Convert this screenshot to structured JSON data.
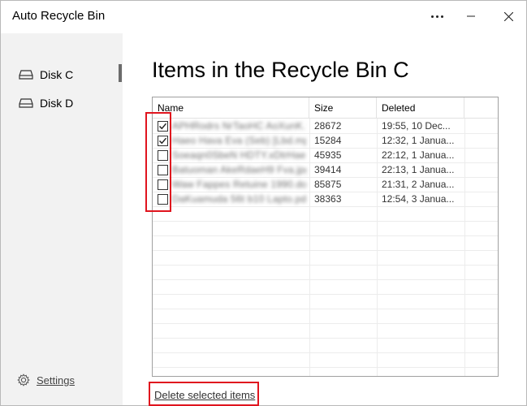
{
  "window": {
    "title": "Auto Recycle Bin"
  },
  "sidebar": {
    "items": [
      {
        "label": "Disk C",
        "icon": "drive-icon",
        "selected": true
      },
      {
        "label": "Disk D",
        "icon": "drive-icon",
        "selected": false
      }
    ],
    "settings_label": "Settings",
    "settings_icon": "gear-icon"
  },
  "main": {
    "title": "Items in the Recycle Bin C",
    "table": {
      "columns": [
        "Name",
        "Size",
        "Deleted"
      ],
      "rows": [
        {
          "checked": true,
          "name": "APHRodrs NrTaoHC AoXunK.txt",
          "size": "28672",
          "deleted": "19:55, 10 Dec..."
        },
        {
          "checked": true,
          "name": "Haeo Hava Eva (Seb) [Lbd.mp4",
          "size": "15284",
          "deleted": "12:32, 1 Janua..."
        },
        {
          "checked": false,
          "name": "Soeaqn0SbeN HDTY.xDtrHaed",
          "size": "45935",
          "deleted": "22:12, 1 Janua..."
        },
        {
          "checked": false,
          "name": "Batuoman AkeRdaeH9 Fva.jpg",
          "size": "39414",
          "deleted": "22:13, 1 Janua..."
        },
        {
          "checked": false,
          "name": "Waw Fappes Retuine 1990.doc",
          "size": "85875",
          "deleted": "21:31, 2 Janua..."
        },
        {
          "checked": false,
          "name": "DaKuamuda 56t b10 Lapto.pdf",
          "size": "38363",
          "deleted": "12:54, 3 Janua..."
        }
      ]
    },
    "delete_label": "Delete selected items"
  },
  "colors": {
    "highlight": "#e0141e",
    "sidebar_bg": "#f2f2f2"
  }
}
